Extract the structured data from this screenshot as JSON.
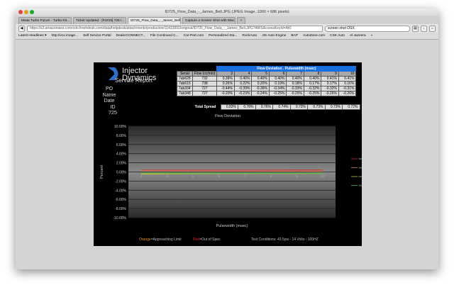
{
  "window": {
    "title": "ID725_Flow_Data_-_James_Bell.JPG (JPEG Image, 1000 × 686 pixels)"
  },
  "tabs": [
    {
      "label": "Miata Turbo Forum - Turbo Kit..."
    },
    {
      "label": "Ticket Updated - [#4215] 725 I..."
    },
    {
      "label": "ID725_Flow_Data_-_James_Bell..."
    },
    {
      "label": "Capture a Screen Shot with Mac..."
    },
    {
      "label": "+"
    }
  ],
  "nav": {
    "url": "https://s3.amazonaws.com/cdn.freshdesk.com/data/helpdesk/attachments/production/11432892/original/ID725_Flow_Data_-_James_Bell.JPG?AWSAccessKeyId=AKI",
    "search": "screen shot OSX"
  },
  "bookmarks": [
    "Latest Headlines ▾",
    "http://vcx.image...",
    "Self Service Portal",
    "DealerCONNECT...",
    "File Continued C...",
    "Car-Part.com",
    "Personalized Sta...",
    "RockAuto",
    "JIS Auto Engine",
    "BAP",
    "AutoZone.com",
    "CSK Auto",
    "Al Jazeera",
    "»"
  ],
  "report": {
    "brand1": "Injector",
    "brand2": "Dynamics",
    "subtitle": "Service Report",
    "meta": [
      "PO",
      "Name",
      "Date",
      "ID 725"
    ],
    "table_title": "Flow Deviation . Pulsewidth (msec)",
    "col_serial": "Serial",
    "col_flow": "Flow (cc/min)",
    "pulsewidths": [
      "3",
      "4",
      "5",
      "6",
      "7",
      "8",
      "9",
      "10"
    ],
    "rows": [
      {
        "serial": "7ab628",
        "flow": "732",
        "vals": [
          "0.39%",
          "0.40%",
          "0.40%",
          "0.40%",
          "0.40%",
          "0.40%",
          "0.41%",
          "0.41%"
        ]
      },
      {
        "serial": "7ab615",
        "flow": "738",
        "vals": [
          "0.26%",
          "0.22%",
          "0.20%",
          "0.19%",
          "0.18%",
          "0.17%",
          "0.17%",
          "0.16%"
        ]
      },
      {
        "serial": "7ab334",
        "flow": "727",
        "vals": [
          "-0.44%",
          "-0.39%",
          "-0.36%",
          "-0.34%",
          "-0.33%",
          "-0.32%",
          "-0.32%",
          "-0.31%"
        ]
      },
      {
        "serial": "7ab348",
        "flow": "727",
        "vals": [
          "-0.20%",
          "-0.23%",
          "-0.24%",
          "-0.25%",
          "-0.25%",
          "-0.25%",
          "-0.26%",
          "-0.26%"
        ]
      }
    ],
    "spread_label": "Total Spread",
    "spread": [
      "0.83%",
      "0.78%",
      "0.76%",
      "0.74%",
      "0.73%",
      "0.73%",
      "0.73%",
      "0.72%"
    ],
    "foot_orange": "Orange",
    "foot_orange_rest": "=Approaching Limit",
    "foot_red": "Red",
    "foot_red_rest": "=Out of Spec",
    "conditions": "Test Conditions: 43.5psi - 14 Volts - 100HZ"
  },
  "chart_data": {
    "type": "line",
    "title": "Flow Deviation",
    "xlabel": "Pulsewidth (msec)",
    "ylabel": "Percent",
    "x": [
      3,
      4,
      5,
      6,
      7,
      8,
      9,
      10
    ],
    "ylim": [
      -10,
      10
    ],
    "yticks": [
      "10.00%",
      "8.00%",
      "6.00%",
      "4.00%",
      "2.00%",
      "0.00%",
      "-2.00%",
      "-4.00%",
      "-6.00%",
      "-8.00%",
      "-10.00%"
    ],
    "series": [
      {
        "name": "7ab628",
        "color": "#c0392b",
        "values": [
          0.39,
          0.4,
          0.4,
          0.4,
          0.4,
          0.4,
          0.41,
          0.41
        ]
      },
      {
        "name": "7ab615",
        "color": "#e07a6a",
        "values": [
          0.26,
          0.22,
          0.2,
          0.19,
          0.18,
          0.17,
          0.17,
          0.16
        ]
      },
      {
        "name": "7ab334",
        "color": "#c8c040",
        "values": [
          -0.44,
          -0.39,
          -0.36,
          -0.34,
          -0.33,
          -0.32,
          -0.32,
          -0.31
        ]
      },
      {
        "name": "7ab348",
        "color": "#40b040",
        "values": [
          -0.2,
          -0.23,
          -0.24,
          -0.25,
          -0.25,
          -0.25,
          -0.26,
          -0.26
        ]
      }
    ],
    "legend": "right",
    "grid": true
  }
}
